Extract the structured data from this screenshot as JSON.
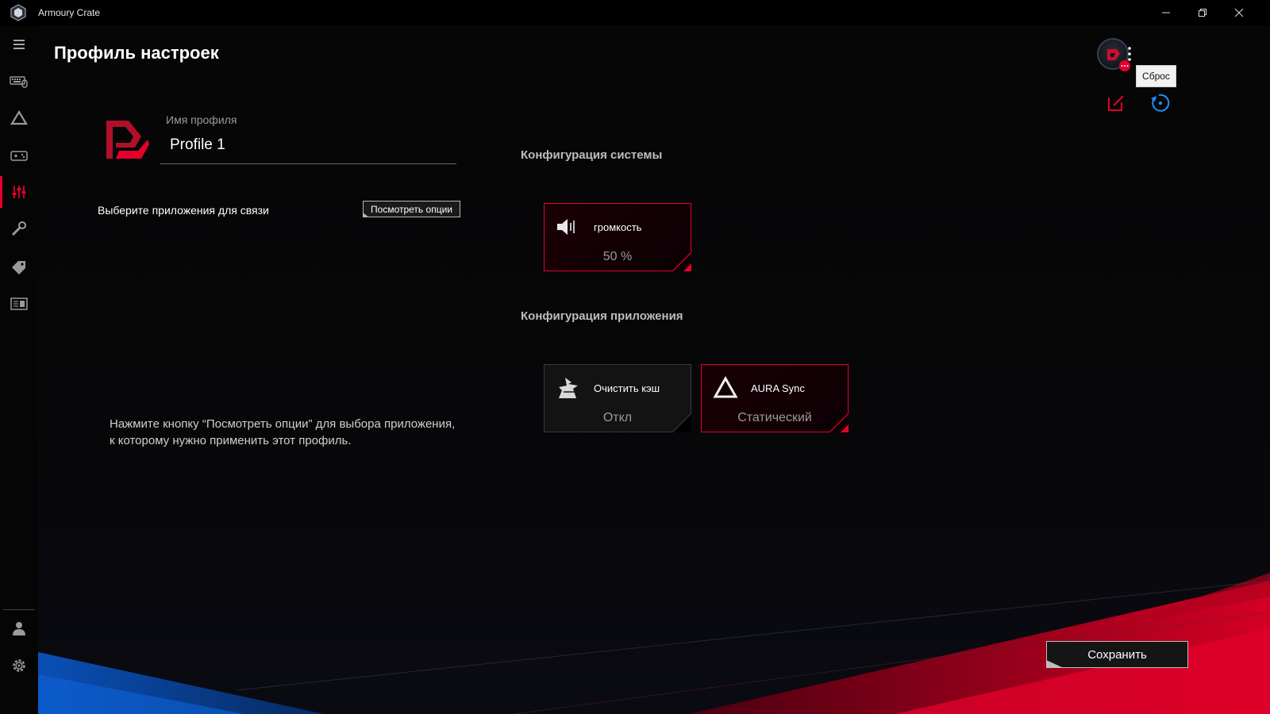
{
  "window": {
    "title": "Armoury Crate",
    "controls": [
      "minimize-icon",
      "restore-icon",
      "close-icon"
    ]
  },
  "sidebar": {
    "items": [
      {
        "icon": "menu-icon"
      },
      {
        "icon": "devices-icon"
      },
      {
        "icon": "aura-icon"
      },
      {
        "icon": "game-library-icon"
      },
      {
        "icon": "scenario-profiles-icon",
        "active": true
      },
      {
        "icon": "tools-icon"
      },
      {
        "icon": "deals-tag-icon"
      },
      {
        "icon": "news-icon"
      },
      {
        "icon": "user-icon"
      },
      {
        "icon": "settings-icon"
      }
    ]
  },
  "header": {
    "title": "Профиль настроек",
    "tooltip": "Сброс"
  },
  "profile": {
    "name_label": "Имя профиля",
    "name_value": "Profile 1",
    "link_apps_label": "Выберите приложения для связи",
    "view_options_button": "Посмотреть опции",
    "hint": "Нажмите кнопку “Посмотреть опции” для выбора приложения, к которому нужно применить этот профиль."
  },
  "system_config": {
    "title": "Конфигурация системы",
    "cards": [
      {
        "icon": "volume-icon",
        "label": "громкость",
        "value": "50 %",
        "style": "red"
      }
    ]
  },
  "app_config": {
    "title": "Конфигурация приложения",
    "cards": [
      {
        "icon": "clear-cache-icon",
        "label": "Очистить кэш",
        "value": "Откл",
        "style": "grey"
      },
      {
        "icon": "aura-sync-icon",
        "label": "AURA Sync",
        "value": "Статический",
        "style": "red"
      }
    ]
  },
  "footer": {
    "save_button": "Сохранить"
  },
  "colors": {
    "accent": "#e4002b",
    "background": "#000000",
    "tooltip_bg": "#f2f2f2",
    "reset_icon": "#1e90ff"
  }
}
